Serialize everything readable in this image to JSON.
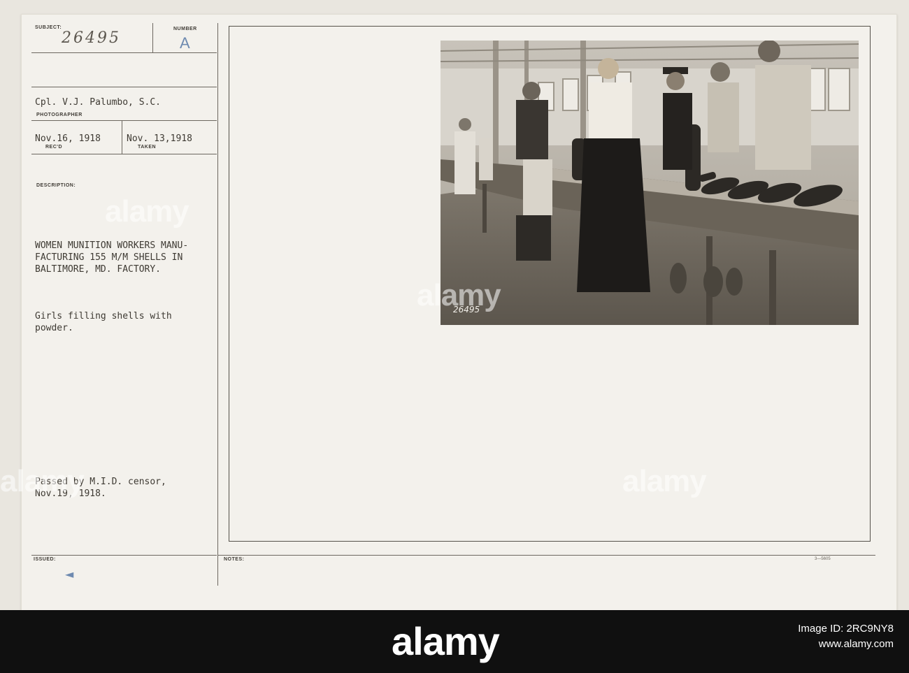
{
  "card": {
    "subject_label": "SUBJECT:",
    "subject_value": "26495",
    "number_label": "NUMBER",
    "number_value": "A",
    "photographer": "Cpl. V.J. Palumbo, S.C.",
    "photographer_label": "PHOTOGRAPHER",
    "received_date": "Nov.16, 1918",
    "received_label": "REC'D",
    "taken_date": "Nov. 13,1918",
    "taken_label": "TAKEN",
    "description_label": "DESCRIPTION:",
    "description_lines": [
      "WOMEN MUNITION WORKERS MANU-",
      "FACTURING 155 M/M SHELLS IN",
      "BALTIMORE, MD. FACTORY."
    ],
    "caption_lines": [
      "Girls filling shells with",
      "powder."
    ],
    "censor_lines": [
      "Passed by M.I.D. censor,",
      "Nov.19, 1918."
    ],
    "issued_label": "ISSUED:",
    "issued_mark": "◄",
    "notes_label": "NOTES:",
    "form_number": "3—5605"
  },
  "photo": {
    "inscription": "26495"
  },
  "watermarks": {
    "text": "alamy"
  },
  "footer": {
    "brand": "alamy",
    "image_id_label": "Image ID: 2RC9NY8",
    "website": "www.alamy.com"
  }
}
